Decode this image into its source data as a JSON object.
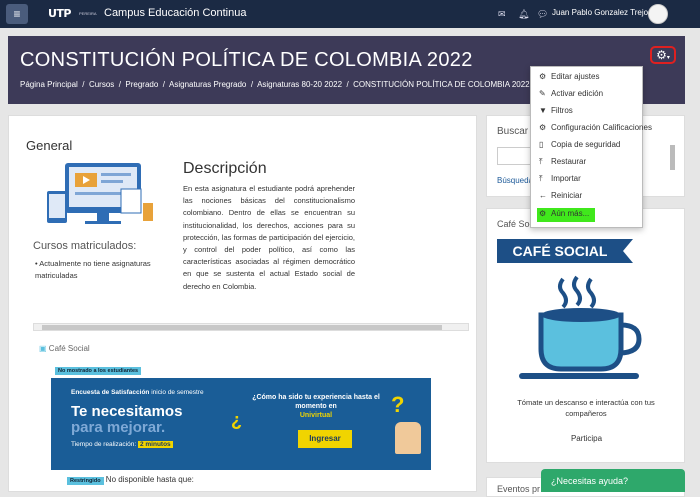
{
  "topbar": {
    "menu_icon": "≡",
    "logo": "UTP",
    "logo_sub": "PEREIRA",
    "site_name": "Campus Educación Continua",
    "user_name": "Juan Pablo Gonzalez Trejo"
  },
  "header": {
    "title": "CONSTITUCIÓN POLÍTICA DE COLOMBIA 2022",
    "breadcrumbs": [
      "Página Principal",
      "Cursos",
      "Pregrado",
      "Asignaturas Pregrado",
      "Asignaturas 80-20 2022",
      "CONSTITUCIÓN POLÍTICA DE COLOMBIA 2022"
    ]
  },
  "settings_menu": [
    {
      "icon": "gear-icon",
      "label": "Editar ajustes"
    },
    {
      "icon": "pencil-icon",
      "label": "Activar edición"
    },
    {
      "icon": "filter-icon",
      "label": "Filtros"
    },
    {
      "icon": "gear-icon",
      "label": "Configuración Calificaciones"
    },
    {
      "icon": "file-icon",
      "label": "Copia de seguridad"
    },
    {
      "icon": "upload-icon",
      "label": "Restaurar"
    },
    {
      "icon": "upload-icon",
      "label": "Importar"
    },
    {
      "icon": "arrow-left-icon",
      "label": "Reiniciar"
    },
    {
      "icon": "gear-icon",
      "label": "Aún más..."
    }
  ],
  "main": {
    "section": "General",
    "desc_title": "Descripción",
    "description": "En esta asignatura el estudiante podrá aprehender las nociones básicas del constitucionalismo colombiano. Dentro de ellas se encuentran su institucionalidad, los derechos, acciones para su protección, las formas de participación del ejercicio, y control del poder político, así como las características asociadas al régimen democrático en que se sustenta el actual Estado social de derecho en Colombia.",
    "enrolled_title": "Cursos matriculados:",
    "enrolled_item": "Actualmente no tiene asignaturas matriculadas",
    "cafe_link": "Café Social",
    "hidden_tag": "No mostrado a los estudiantes",
    "banner": {
      "survey": "Encuesta de Satisfacción",
      "survey_rest": " inicio de semestre",
      "big1": "Te necesitamos",
      "big2": "para mejorar.",
      "time_label": "Tiempo de realización:",
      "time": "2 minutos",
      "question": "¿Cómo ha sido tu experiencia hasta el momento en",
      "brand": "Univirtual",
      "button": "Ingresar"
    },
    "restricted_tag": "Restringido",
    "restricted_text": "No disponible hasta que:"
  },
  "sidebar": {
    "search_title": "Buscar e",
    "search_link": "Búsqueda",
    "cafe_title": "Café Social",
    "cafe_banner": "CAFÉ SOCIAL",
    "cafe_text": "Tómate un descanso e interactúa con tus compañeros",
    "participa": "Participa",
    "events": "Eventos pr"
  },
  "chat": {
    "label": "¿Necesitas ayuda?"
  },
  "colors": {
    "topbar": "#1b2a44",
    "header": "#3d3a58",
    "highlight": "#40e81c",
    "cafe": "#1d4f86",
    "chat": "#2ea86b"
  }
}
